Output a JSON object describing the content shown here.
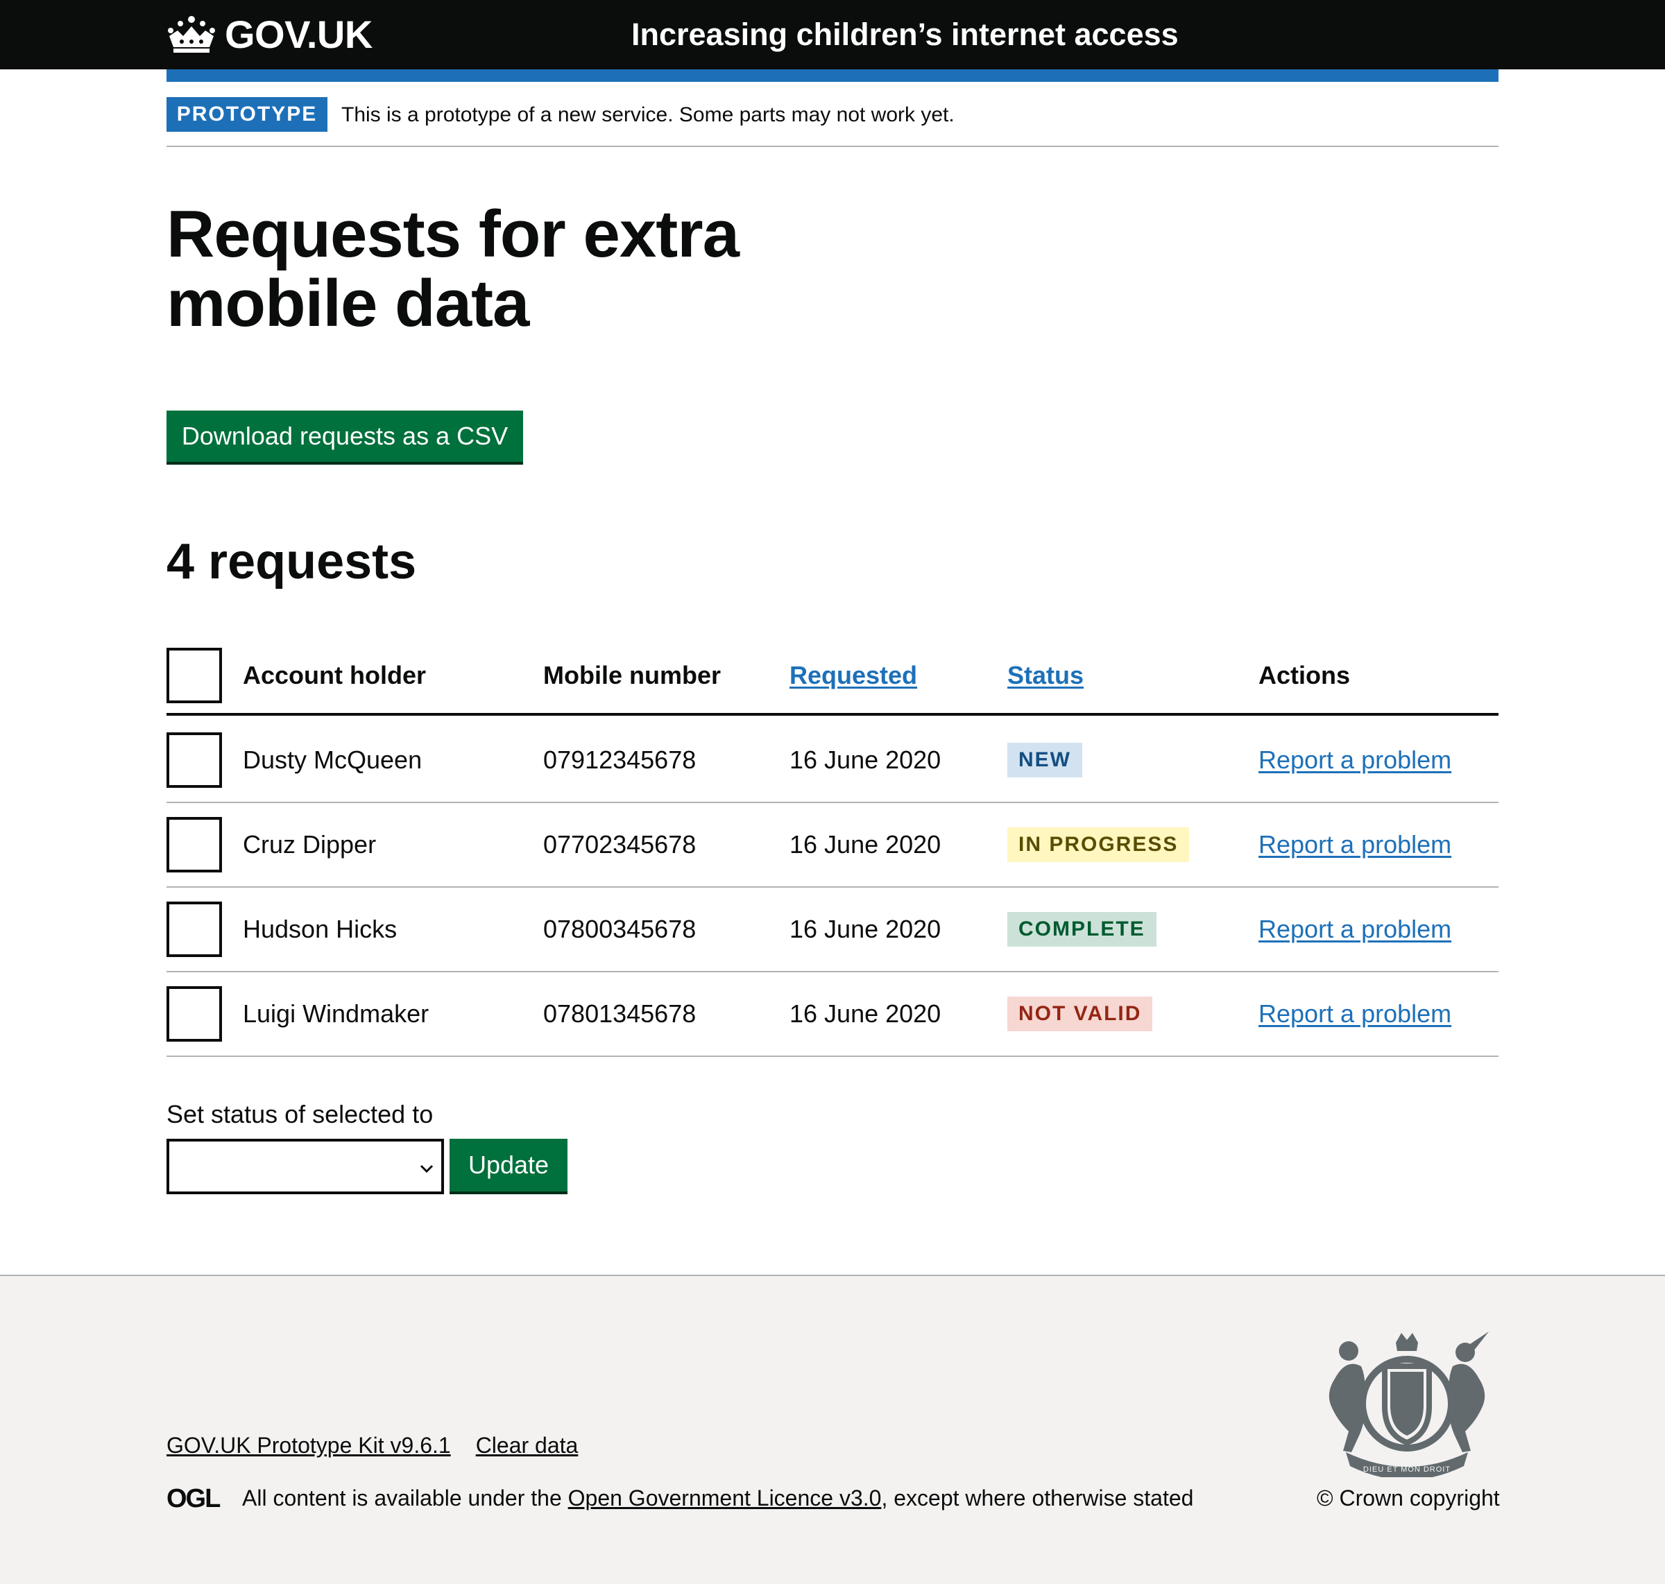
{
  "header": {
    "logo_text": "GOV.UK",
    "service_name": "Increasing children’s internet access"
  },
  "phase_banner": {
    "tag": "PROTOTYPE",
    "text": "This is a prototype of a new service. Some parts may not work yet."
  },
  "page": {
    "title": "Requests for extra mobile data",
    "download_button": "Download requests as a CSV",
    "count_heading": "4 requests"
  },
  "table": {
    "headers": {
      "account_holder": "Account holder",
      "mobile_number": "Mobile number",
      "requested": "Requested",
      "status": "Status",
      "actions": "Actions"
    },
    "rows": [
      {
        "name": "Dusty McQueen",
        "mobile": "07912345678",
        "requested": "16 June 2020",
        "status": "NEW",
        "status_bg": "#d2e2f1",
        "status_fg": "#144e81",
        "action": "Report a problem"
      },
      {
        "name": "Cruz Dipper",
        "mobile": "07702345678",
        "requested": "16 June 2020",
        "status": "IN PROGRESS",
        "status_bg": "#fff7bf",
        "status_fg": "#594d00",
        "action": "Report a problem"
      },
      {
        "name": "Hudson Hicks",
        "mobile": "07800345678",
        "requested": "16 June 2020",
        "status": "COMPLETE",
        "status_bg": "#cce2d8",
        "status_fg": "#005a30",
        "action": "Report a problem"
      },
      {
        "name": "Luigi Windmaker",
        "mobile": "07801345678",
        "requested": "16 June 2020",
        "status": "NOT VALID",
        "status_bg": "#f6d7d2",
        "status_fg": "#942514",
        "action": "Report a problem"
      }
    ]
  },
  "bulk_action": {
    "label": "Set status of selected to",
    "selected_value": "",
    "button": "Update"
  },
  "footer": {
    "links": [
      "GOV.UK Prototype Kit v9.6.1",
      "Clear data"
    ],
    "licence_prefix": "All content is available under the ",
    "licence_link": "Open Government Licence v3.0",
    "licence_suffix": ", except where otherwise stated",
    "copyright": "© Crown copyright",
    "ogl_logo_text": "OGL",
    "crest_motto": "DIEU ET MON DROIT"
  },
  "colors": {
    "header_bg": "#0b0c0c",
    "brand_blue": "#1d70b8",
    "button_green": "#00703c",
    "link_blue": "#1d70b8",
    "footer_bg": "#f3f2f1"
  },
  "icons": {
    "logo": "crown-icon",
    "select": "chevron-down-icon",
    "footer_crest": "royal-coat-of-arms-icon",
    "licence": "ogl-logo-icon"
  }
}
